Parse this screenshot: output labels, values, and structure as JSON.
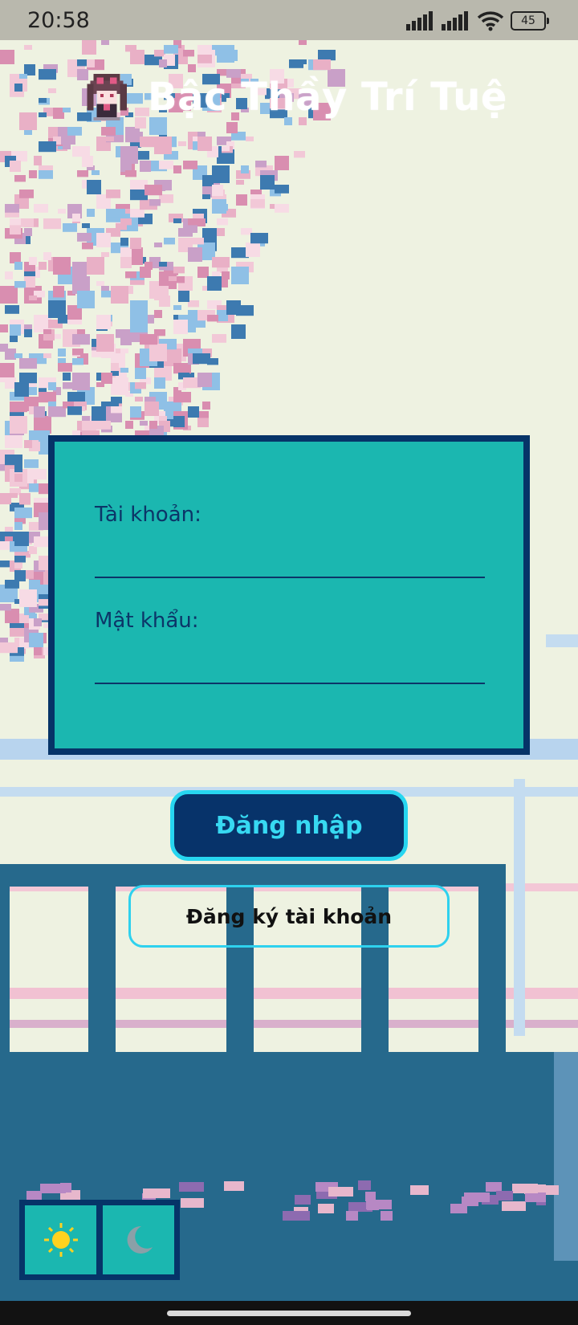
{
  "status_bar": {
    "time": "20:58",
    "battery": "45",
    "icons": [
      "signal-icon",
      "signal-icon",
      "wifi-icon",
      "battery-icon"
    ]
  },
  "header": {
    "title": "Bậc Thầy Trí Tuệ",
    "avatar_icon": "anime-girl-avatar"
  },
  "login_form": {
    "username_label": "Tài khoản:",
    "username_value": "",
    "password_label": "Mật khẩu:",
    "password_value": ""
  },
  "buttons": {
    "login": "Đăng nhập",
    "register": "Đăng ký tài khoản"
  },
  "theme_toggle": {
    "light_icon": "sun-icon",
    "dark_icon": "moon-icon"
  },
  "colors": {
    "card_bg": "#1bb7b0",
    "card_border": "#063468",
    "accent": "#27d6f0",
    "background": "#eef2e1",
    "dark_blue": "#26698c"
  }
}
